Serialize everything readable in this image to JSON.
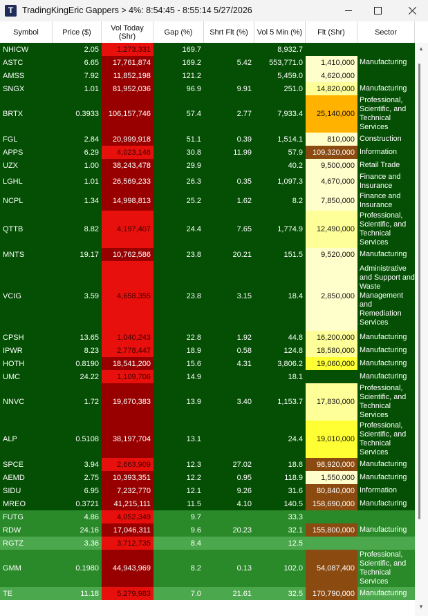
{
  "window": {
    "title": "TradingKingEric Gappers > 4%:  8:54:45 - 8:55:14   5/27/2026",
    "app_icon_letter": "T"
  },
  "columns": [
    "Symbol",
    "Price ($)",
    "Vol Today (Shr)",
    "Gap (%)",
    "Shrt Flt (%)",
    "Vol 5 Min (%)",
    "Flt (Shr)",
    "Sector"
  ],
  "colors": {
    "row_dark_green": "#044f04",
    "row_green": "#2a8a2a",
    "row_light_green": "#4ca84c",
    "vol_bright_red": "#e8100c",
    "vol_dark_red": "#980000",
    "flt_pale_yellow": "#ffffcc",
    "flt_light_yellow": "#ffff99",
    "flt_yellow": "#ffff33",
    "flt_orange": "#ffb300",
    "flt_brown": "#8a4a10"
  },
  "rows": [
    {
      "symbol": "NHICW",
      "price": "2.05",
      "vol_today": "1,273,331",
      "gap": "169.7",
      "shrt_flt": "",
      "vol5": "8,932.7",
      "flt": "",
      "sector": ""
    },
    {
      "symbol": "ASTC",
      "price": "6.65",
      "vol_today": "17,761,874",
      "gap": "169.2",
      "shrt_flt": "5.42",
      "vol5": "553,771.0",
      "flt": "1,410,000",
      "sector": "Manufacturing"
    },
    {
      "symbol": "AMSS",
      "price": "7.92",
      "vol_today": "11,852,198",
      "gap": "121.2",
      "shrt_flt": "",
      "vol5": "5,459.0",
      "flt": "4,620,000",
      "sector": ""
    },
    {
      "symbol": "SNGX",
      "price": "1.01",
      "vol_today": "81,952,036",
      "gap": "96.9",
      "shrt_flt": "9.91",
      "vol5": "251.0",
      "flt": "14,820,000",
      "sector": "Manufacturing"
    },
    {
      "symbol": "BRTX",
      "price": "0.3933",
      "vol_today": "106,157,746",
      "gap": "57.4",
      "shrt_flt": "2.77",
      "vol5": "7,933.4",
      "flt": "25,140,000",
      "sector": "Professional, Scientific, and Technical Services"
    },
    {
      "symbol": "FGL",
      "price": "2.84",
      "vol_today": "20,999,918",
      "gap": "51.1",
      "shrt_flt": "0.39",
      "vol5": "1,514.1",
      "flt": "810,000",
      "sector": "Construction"
    },
    {
      "symbol": "APPS",
      "price": "6.29",
      "vol_today": "4,023,146",
      "gap": "30.8",
      "shrt_flt": "11.99",
      "vol5": "57.9",
      "flt": "109,320,000",
      "sector": "Information"
    },
    {
      "symbol": "UZX",
      "price": "1.00",
      "vol_today": "38,243,478",
      "gap": "29.9",
      "shrt_flt": "",
      "vol5": "40.2",
      "flt": "9,500,000",
      "sector": "Retail Trade"
    },
    {
      "symbol": "LGHL",
      "price": "1.01",
      "vol_today": "26,569,233",
      "gap": "26.3",
      "shrt_flt": "0.35",
      "vol5": "1,097.3",
      "flt": "4,670,000",
      "sector": "Finance and Insurance"
    },
    {
      "symbol": "NCPL",
      "price": "1.34",
      "vol_today": "14,998,813",
      "gap": "25.2",
      "shrt_flt": "1.62",
      "vol5": "8.2",
      "flt": "7,850,000",
      "sector": "Finance and Insurance"
    },
    {
      "symbol": "QTTB",
      "price": "8.82",
      "vol_today": "4,197,407",
      "gap": "24.4",
      "shrt_flt": "7.65",
      "vol5": "1,774.9",
      "flt": "12,490,000",
      "sector": "Professional, Scientific, and Technical Services"
    },
    {
      "symbol": "MNTS",
      "price": "19.17",
      "vol_today": "10,762,586",
      "gap": "23.8",
      "shrt_flt": "20.21",
      "vol5": "151.5",
      "flt": "9,520,000",
      "sector": "Manufacturing"
    },
    {
      "symbol": "VCIG",
      "price": "3.59",
      "vol_today": "4,658,355",
      "gap": "23.8",
      "shrt_flt": "3.15",
      "vol5": "18.4",
      "flt": "2,850,000",
      "sector": "Administrative and Support and Waste Management and Remediation Services"
    },
    {
      "symbol": "CPSH",
      "price": "13.65",
      "vol_today": "1,040,243",
      "gap": "22.8",
      "shrt_flt": "1.92",
      "vol5": "44.8",
      "flt": "16,200,000",
      "sector": "Manufacturing"
    },
    {
      "symbol": "IPWR",
      "price": "8.23",
      "vol_today": "2,778,447",
      "gap": "18.9",
      "shrt_flt": "0.58",
      "vol5": "124.8",
      "flt": "18,580,000",
      "sector": "Manufacturing"
    },
    {
      "symbol": "HOTH",
      "price": "0.8190",
      "vol_today": "18,541,200",
      "gap": "15.6",
      "shrt_flt": "4.31",
      "vol5": "3,806.2",
      "flt": "19,060,000",
      "sector": "Manufacturing"
    },
    {
      "symbol": "UMC",
      "price": "24.22",
      "vol_today": "1,109,706",
      "gap": "14.9",
      "shrt_flt": "",
      "vol5": "18.1",
      "flt": "",
      "sector": "Manufacturing"
    },
    {
      "symbol": "NNVC",
      "price": "1.72",
      "vol_today": "19,670,383",
      "gap": "13.9",
      "shrt_flt": "3.40",
      "vol5": "1,153.7",
      "flt": "17,830,000",
      "sector": "Professional, Scientific, and Technical Services"
    },
    {
      "symbol": "ALP",
      "price": "0.5108",
      "vol_today": "38,197,704",
      "gap": "13.1",
      "shrt_flt": "",
      "vol5": "24.4",
      "flt": "19,010,000",
      "sector": "Professional, Scientific, and Technical Services"
    },
    {
      "symbol": "SPCE",
      "price": "3.94",
      "vol_today": "2,663,909",
      "gap": "12.3",
      "shrt_flt": "27.02",
      "vol5": "18.8",
      "flt": "98,920,000",
      "sector": "Manufacturing"
    },
    {
      "symbol": "AEMD",
      "price": "2.75",
      "vol_today": "10,393,351",
      "gap": "12.2",
      "shrt_flt": "0.95",
      "vol5": "118.9",
      "flt": "1,550,000",
      "sector": "Manufacturing"
    },
    {
      "symbol": "SIDU",
      "price": "6.95",
      "vol_today": "7,232,770",
      "gap": "12.1",
      "shrt_flt": "9.26",
      "vol5": "31.6",
      "flt": "80,840,000",
      "sector": "Information"
    },
    {
      "symbol": "MREO",
      "price": "0.3721",
      "vol_today": "41,215,111",
      "gap": "11.5",
      "shrt_flt": "4.10",
      "vol5": "140.5",
      "flt": "158,690,000",
      "sector": "Manufacturing"
    },
    {
      "symbol": "FUTG",
      "price": "4.86",
      "vol_today": "4,052,349",
      "gap": "9.7",
      "shrt_flt": "",
      "vol5": "33.3",
      "flt": "",
      "sector": ""
    },
    {
      "symbol": "RDW",
      "price": "24.16",
      "vol_today": "17,046,311",
      "gap": "9.6",
      "shrt_flt": "20.23",
      "vol5": "32.1",
      "flt": "155,800,000",
      "sector": "Manufacturing"
    },
    {
      "symbol": "RGTZ",
      "price": "3.36",
      "vol_today": "3,712,735",
      "gap": "8.4",
      "shrt_flt": "",
      "vol5": "12.5",
      "flt": "",
      "sector": ""
    },
    {
      "symbol": "GMM",
      "price": "0.1980",
      "vol_today": "44,943,969",
      "gap": "8.2",
      "shrt_flt": "0.13",
      "vol5": "102.0",
      "flt": "54,087,400",
      "sector": "Professional, Scientific, and Technical Services"
    },
    {
      "symbol": "TE",
      "price": "11.18",
      "vol_today": "5,279,983",
      "gap": "7.0",
      "shrt_flt": "21.61",
      "vol5": "32.5",
      "flt": "170,790,000",
      "sector": "Manufacturing"
    }
  ]
}
